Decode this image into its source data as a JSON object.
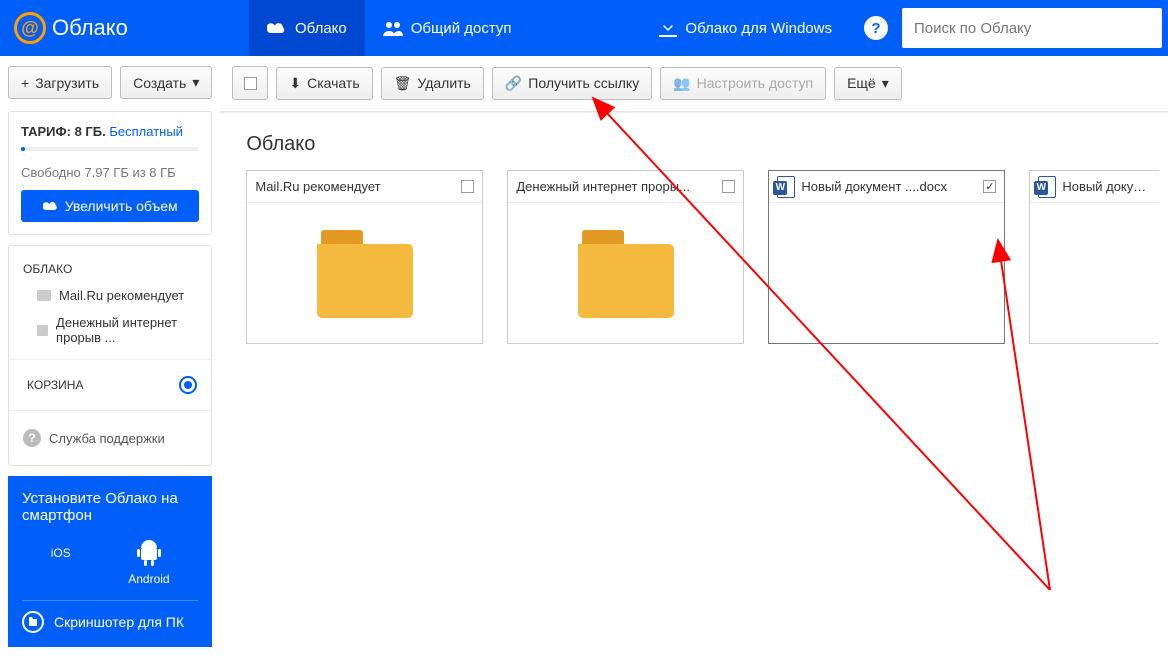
{
  "header": {
    "logo_text": "Облако",
    "nav_cloud": "Облако",
    "nav_shared": "Общий доступ",
    "nav_download": "Облако для Windows",
    "search_placeholder": "Поиск по Облаку"
  },
  "sidebar": {
    "upload_label": "Загрузить",
    "create_label": "Создать",
    "tariff_label": "ТАРИФ:",
    "tariff_size": "8 ГБ.",
    "tariff_plan": "Бесплатный",
    "free_text": "Свободно 7.97 ГБ из 8 ГБ",
    "expand_btn": "Увеличить объем",
    "cloud_section": "ОБЛАКО",
    "tree_item1": "Mail.Ru рекомендует",
    "tree_item2": "Денежный интернет прорыв ...",
    "trash_section": "КОРЗИНА",
    "support_label": "Служба поддержки",
    "promo_title": "Установите Облако на смартфон",
    "promo_ios": "iOS",
    "promo_android": "Android",
    "promo_footer": "Скриншотер для ПК"
  },
  "toolbar": {
    "download": "Скачать",
    "delete": "Удалить",
    "getlink": "Получить ссылку",
    "share": "Настроить доступ",
    "more": "Ещё"
  },
  "breadcrumb": "Облако",
  "files": [
    {
      "title": "Mail.Ru рекомендует",
      "type": "folder",
      "selected": false
    },
    {
      "title": "Денежный интернет проры...",
      "type": "folder",
      "selected": false
    },
    {
      "title": "Новый документ ....docx",
      "type": "word",
      "selected": true
    },
    {
      "title": "Новый докумен",
      "type": "word",
      "selected": false
    }
  ]
}
